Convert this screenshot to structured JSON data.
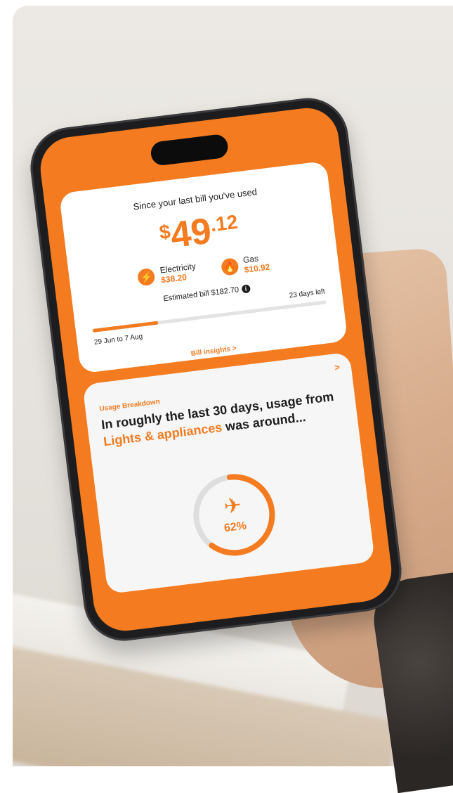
{
  "summary": {
    "since_text": "Since your last bill you've used",
    "currency": "$",
    "amount_whole": "49",
    "amount_cents": ".12",
    "electricity": {
      "label": "Electricity",
      "value": "$38.20",
      "icon": "lightning-bolt-icon"
    },
    "gas": {
      "label": "Gas",
      "value": "$10.92",
      "icon": "flame-icon"
    },
    "estimated_bill": "Estimated bill $182.70",
    "days_left": "23 days left",
    "period": "29 Jun to 7 Aug",
    "progress_fraction": 0.28,
    "insights_link": "Bill insights",
    "insights_chevron": ">"
  },
  "usage": {
    "section_label": "Usage Breakdown",
    "chevron": ">",
    "text_before": "In roughly the last 30 days, usage from ",
    "highlight": "Lights & appliances",
    "text_after": " was around...",
    "icon": "appliance-icon",
    "percent_text": "62%",
    "percent_value": 62
  },
  "colors": {
    "brand_orange": "#f47b20",
    "ring_track": "#dedede",
    "text_dark": "#1d1d1f"
  }
}
